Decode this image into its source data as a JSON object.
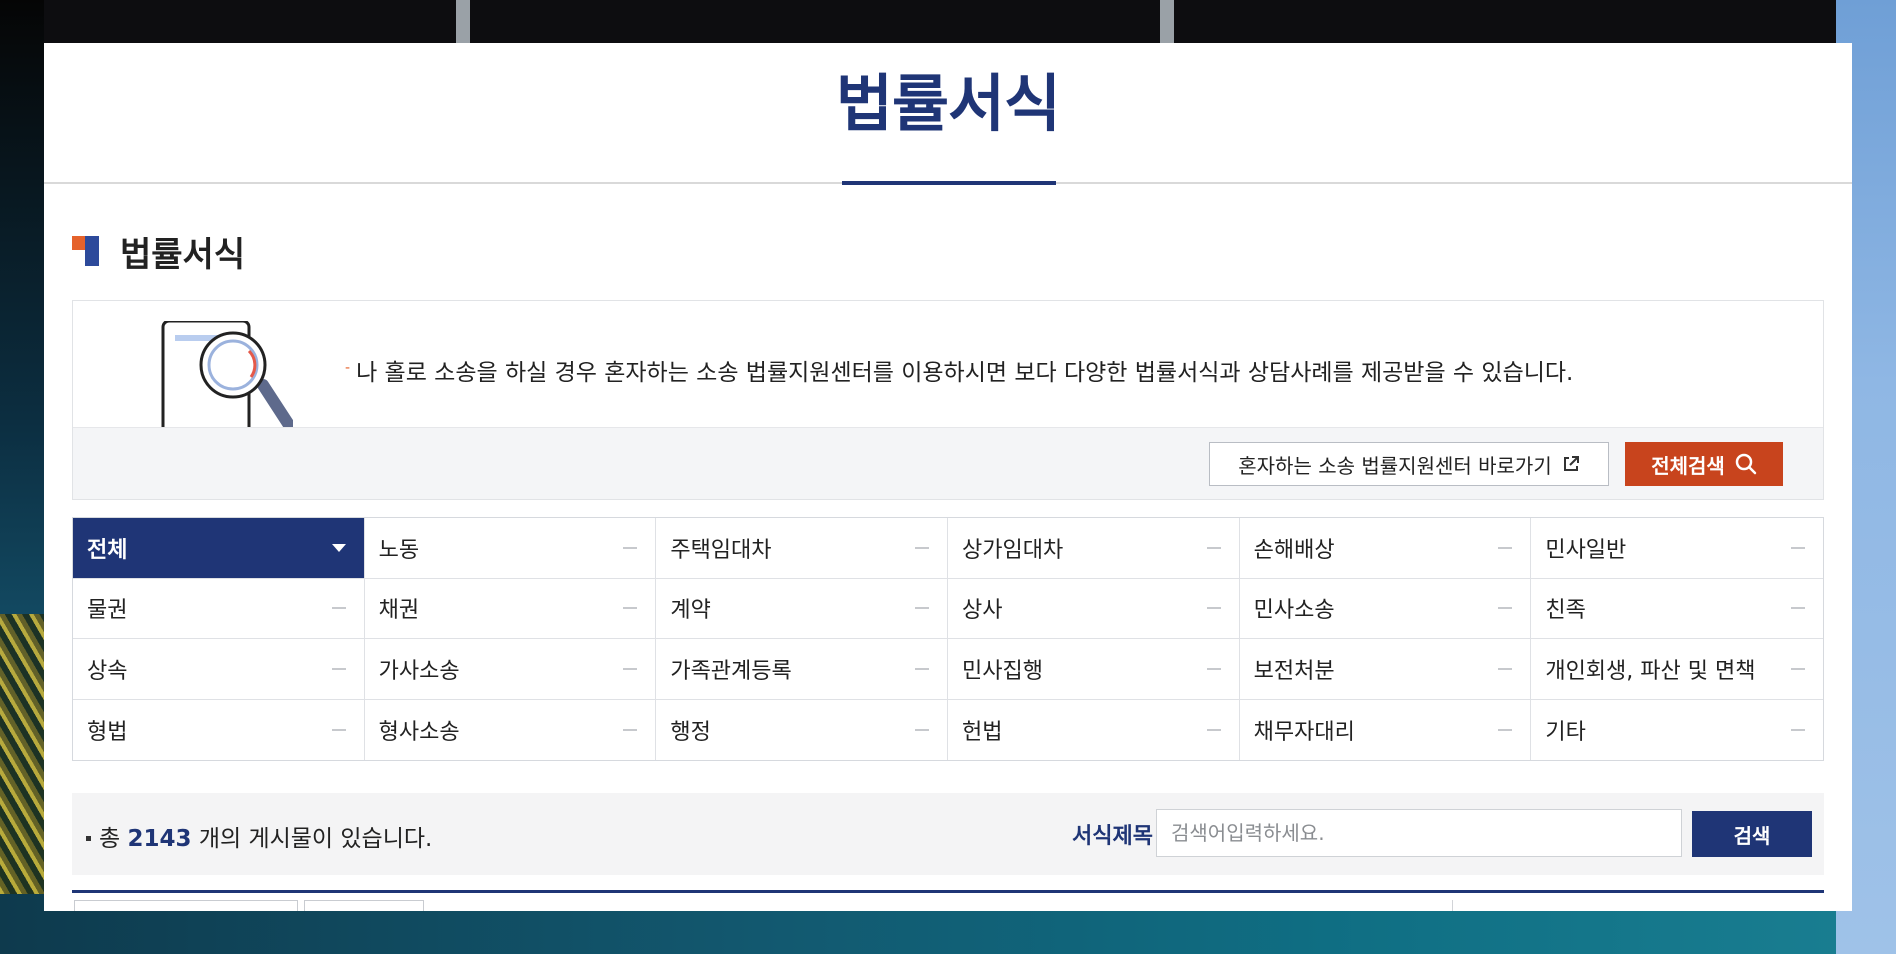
{
  "header": {
    "title": "법률서식"
  },
  "section": {
    "title": "법률서식"
  },
  "intro": {
    "text": "나 홀로 소송을 하실 경우 혼자하는 소송 법률지원센터를 이용하시면 보다 다양한 법률서식과 상담사례를 제공받을 수 있습니다.",
    "link_button_label": "혼자하는 소송 법률지원센터 바로가기",
    "search_all_label": "전체검색"
  },
  "categories": [
    "전체",
    "노동",
    "주택임대차",
    "상가임대차",
    "손해배상",
    "민사일반",
    "물권",
    "채권",
    "계약",
    "상사",
    "민사소송",
    "친족",
    "상속",
    "가사소송",
    "가족관계등록",
    "민사집행",
    "보전처분",
    "개인회생, 파산 및 면책",
    "형법",
    "형사소송",
    "행정",
    "헌법",
    "채무자대리",
    "기타"
  ],
  "selected_category": "전체",
  "search": {
    "total_prefix": "총",
    "total_count": "2143",
    "total_suffix": "개의 게시물이 있습니다.",
    "field_label": "서식제목",
    "placeholder": "검색어입력하세요.",
    "button_label": "검색"
  },
  "icons": {
    "section_mark": "section-mark-icon",
    "illustration": "document-magnifier-icon",
    "external_link": "external-link-icon",
    "search": "search-icon",
    "expand": "caret-down-icon",
    "collapsed": "minus-icon"
  },
  "colors": {
    "primary": "#1f3576",
    "accent": "#c8441d",
    "orange": "#e5622b"
  }
}
